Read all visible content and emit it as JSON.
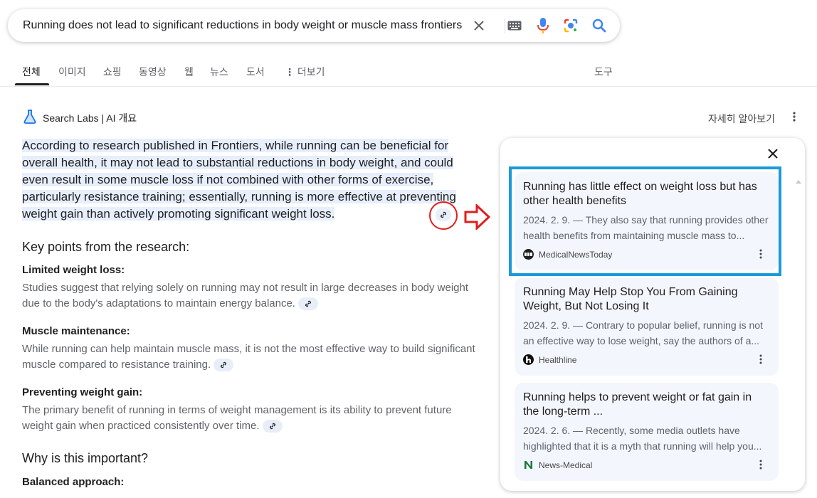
{
  "search": {
    "query": "Running does not lead to significant reductions in body weight or muscle mass frontiers"
  },
  "tabs": [
    {
      "label": "전체",
      "active": true
    },
    {
      "label": "이미지"
    },
    {
      "label": "쇼핑"
    },
    {
      "label": "동영상"
    },
    {
      "label": "웹"
    },
    {
      "label": "뉴스"
    },
    {
      "label": "도서"
    },
    {
      "label": "더보기"
    }
  ],
  "tools_label": "도구",
  "ai_overview": {
    "header": "Search Labs | AI 개요",
    "learn_more": "자세히 알아보기",
    "intro": "According to research published in Frontiers, while running can be beneficial for overall health, it may not lead to substantial reductions in body weight, and could even result in some muscle loss if not combined with other forms of exercise, particularly resistance training; essentially, running is more effective at preventing weight gain than actively promoting significant weight loss.",
    "key_points_heading": "Key points from the research:",
    "points": [
      {
        "title": "Limited weight loss:",
        "body": "Studies suggest that relying solely on running may not result in large decreases in body weight due to the body's adaptations to maintain energy balance."
      },
      {
        "title": "Muscle maintenance:",
        "body": "While running can help maintain muscle mass, it is not the most effective way to build significant muscle compared to resistance training."
      },
      {
        "title": "Preventing weight gain:",
        "body": "The primary benefit of running in terms of weight management is its ability to prevent future weight gain when practiced consistently over time."
      }
    ],
    "why_heading": "Why is this important?",
    "balanced_title": "Balanced approach:"
  },
  "sources": [
    {
      "title": "Running has little effect on weight loss but has other health benefits",
      "snippet": "2024. 2. 9. — They also say that running provides other health benefits from maintaining muscle mass to...",
      "source": "MedicalNewsToday",
      "favicon_color": "#1f1f1f"
    },
    {
      "title": "Running May Help Stop You From Gaining Weight, But Not Losing It",
      "snippet": "2024. 2. 9. — Contrary to popular belief, running is not an effective way to lose weight, say the authors of a...",
      "source": "Healthline",
      "favicon_color": "#111111"
    },
    {
      "title": "Running helps to prevent weight or fat gain in the long-term ...",
      "snippet": "2024. 2. 6. — Recently, some media outlets have highlighted that it is a myth that running will help you...",
      "source": "News-Medical",
      "favicon_color": "#1a7a3a"
    }
  ],
  "colors": {
    "annotation_red": "#e01e1e",
    "highlight_box_blue": "#1a9ad9",
    "card_bg": "#f3f6fc"
  }
}
